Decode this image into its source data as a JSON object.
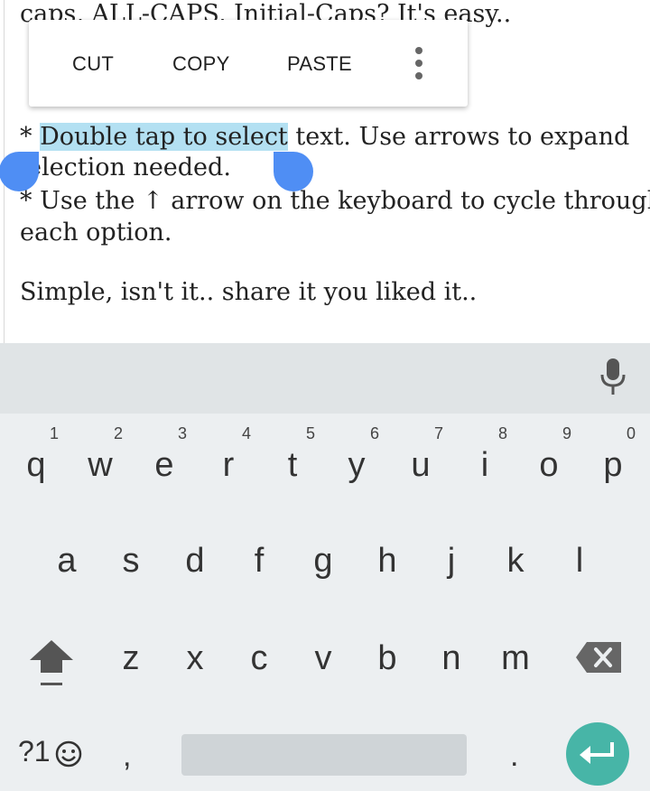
{
  "document": {
    "line0": "caps, ALL-CAPS, Initial-Caps? It's easy..",
    "line1_prefix": "* ",
    "line1_selected": "Double tap to select",
    "line1_rest": " text. Use arrows to expand",
    "line2": "election needed.",
    "line3": "* Use the ↑ arrow on the keyboard to cycle through",
    "line4": "each option.",
    "line5": "Simple, isn't it.. share it you liked it.."
  },
  "context_menu": {
    "cut": "CUT",
    "copy": "COPY",
    "paste": "PASTE"
  },
  "keyboard": {
    "row1": [
      {
        "key": "q",
        "hint": "1"
      },
      {
        "key": "w",
        "hint": "2"
      },
      {
        "key": "e",
        "hint": "3"
      },
      {
        "key": "r",
        "hint": "4"
      },
      {
        "key": "t",
        "hint": "5"
      },
      {
        "key": "y",
        "hint": "6"
      },
      {
        "key": "u",
        "hint": "7"
      },
      {
        "key": "i",
        "hint": "8"
      },
      {
        "key": "o",
        "hint": "9"
      },
      {
        "key": "p",
        "hint": "0"
      }
    ],
    "row2": [
      "a",
      "s",
      "d",
      "f",
      "g",
      "h",
      "j",
      "k",
      "l"
    ],
    "row3": [
      "z",
      "x",
      "c",
      "v",
      "b",
      "n",
      "m"
    ],
    "symbols_label": "?1",
    "comma": ",",
    "period": "."
  },
  "colors": {
    "selection": "#b3e0f2",
    "handle": "#4f8ef4",
    "enter_key": "#47b5a7",
    "keyboard_bg": "#eceff1"
  },
  "icons": [
    "mic-icon",
    "shift-icon",
    "backspace-icon",
    "emoji-icon",
    "enter-icon",
    "overflow-menu-icon"
  ]
}
